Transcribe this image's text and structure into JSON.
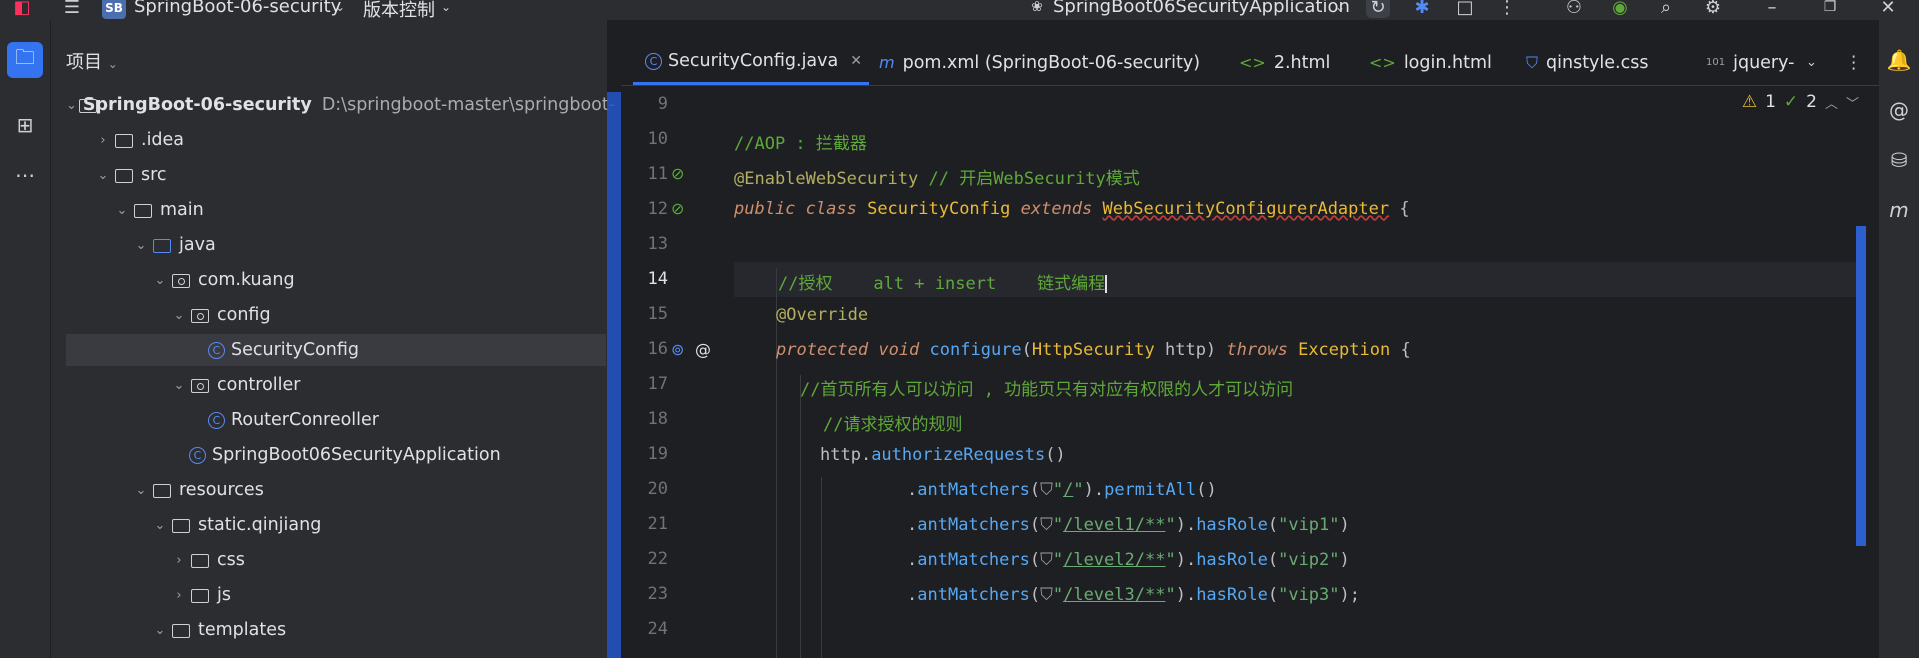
{
  "titlebar": {
    "project_badge": "SB",
    "project_name": "SpringBoot-06-security",
    "vcs_label": "版本控制",
    "run_config": "SpringBoot06SecurityApplication"
  },
  "project_panel": {
    "title": "项目",
    "tree": [
      {
        "label": "SpringBoot-06-security",
        "path": "D:\\springboot-master\\springboot-",
        "depth": 0,
        "type": "module",
        "expanded": true
      },
      {
        "label": ".idea",
        "depth": 1,
        "type": "folder",
        "expanded": false
      },
      {
        "label": "src",
        "depth": 1,
        "type": "folder",
        "expanded": true
      },
      {
        "label": "main",
        "depth": 2,
        "type": "folder",
        "expanded": true
      },
      {
        "label": "java",
        "depth": 3,
        "type": "source-folder",
        "expanded": true
      },
      {
        "label": "com.kuang",
        "depth": 4,
        "type": "package",
        "expanded": true
      },
      {
        "label": "config",
        "depth": 5,
        "type": "package",
        "expanded": true
      },
      {
        "label": "SecurityConfig",
        "depth": 6,
        "type": "class",
        "selected": true
      },
      {
        "label": "controller",
        "depth": 5,
        "type": "package",
        "expanded": true
      },
      {
        "label": "RouterConreoller",
        "depth": 6,
        "type": "class"
      },
      {
        "label": "SpringBoot06SecurityApplication",
        "depth": 5,
        "type": "app-class"
      },
      {
        "label": "resources",
        "depth": 3,
        "type": "resources",
        "expanded": true
      },
      {
        "label": "static.qinjiang",
        "depth": 4,
        "type": "folder",
        "expanded": true
      },
      {
        "label": "css",
        "depth": 5,
        "type": "folder",
        "expanded": false
      },
      {
        "label": "js",
        "depth": 5,
        "type": "folder",
        "expanded": false
      },
      {
        "label": "templates",
        "depth": 4,
        "type": "folder",
        "expanded": true
      }
    ]
  },
  "tabs": [
    {
      "label": "SecurityConfig.java",
      "icon": "class-icon",
      "active": true
    },
    {
      "label": "pom.xml (SpringBoot-06-security)",
      "icon": "maven-icon"
    },
    {
      "label": "2.html",
      "icon": "html-icon"
    },
    {
      "label": "login.html",
      "icon": "html-icon"
    },
    {
      "label": "qinstyle.css",
      "icon": "css-icon"
    },
    {
      "label": "jquery-",
      "icon": "js-icon"
    }
  ],
  "inspections": {
    "warnings": "1",
    "weak_warnings": "2"
  },
  "editor": {
    "line_numbers": [
      "9",
      "10",
      "11",
      "12",
      "13",
      "14",
      "15",
      "16",
      "17",
      "18",
      "19",
      "20",
      "21",
      "22",
      "23",
      "24"
    ],
    "current_line": "14",
    "lines": {
      "l10": "//AOP : 拦截器",
      "l11_ann": "@EnableWebSecurity",
      "l11_cm": "// 开启WebSecurity模式",
      "l12_kw1": "public class",
      "l12_name": "SecurityConfig",
      "l12_kw2": "extends",
      "l12_super": "WebSecurityConfigurerAdapter",
      "l12_brace": "{",
      "l14": "//授权    alt + insert    链式编程",
      "l15": "@Override",
      "l16_kw": "protected void",
      "l16_fn": "configure",
      "l16_p1": "(",
      "l16_type": "HttpSecurity",
      "l16_arg": " http) ",
      "l16_throws": "throws",
      "l16_exc": "Exception",
      "l16_end": " {",
      "l17": "//首页所有人可以访问 , 功能页只有对应有权限的人才可以访问",
      "l18": "//请求授权的规则",
      "l19_obj": "http.",
      "l19_fn": "authorizeRequests",
      "l19_end": "()",
      "l20": {
        "pre": ".",
        "fn": "antMatchers",
        "p": "(",
        "q1": "\"",
        "s": "/",
        "q2": "\"",
        "mid": ").",
        "fn2": "permitAll",
        "end": "()"
      },
      "l21": {
        "pre": ".",
        "fn": "antMatchers",
        "p": "(",
        "q1": "\"",
        "s": "/level1/**",
        "q2": "\"",
        "mid": ").",
        "fn2": "hasRole",
        "arg": "\"vip1\"",
        "end": ")"
      },
      "l22": {
        "pre": ".",
        "fn": "antMatchers",
        "p": "(",
        "q1": "\"",
        "s": "/level2/**",
        "q2": "\"",
        "mid": ").",
        "fn2": "hasRole",
        "arg": "\"vip2\"",
        "end": ")"
      },
      "l23": {
        "pre": ".",
        "fn": "antMatchers",
        "p": "(",
        "q1": "\"",
        "s": "/level3/**",
        "q2": "\"",
        "mid": ").",
        "fn2": "hasRole",
        "arg": "\"vip3\"",
        "end": ");"
      }
    }
  }
}
